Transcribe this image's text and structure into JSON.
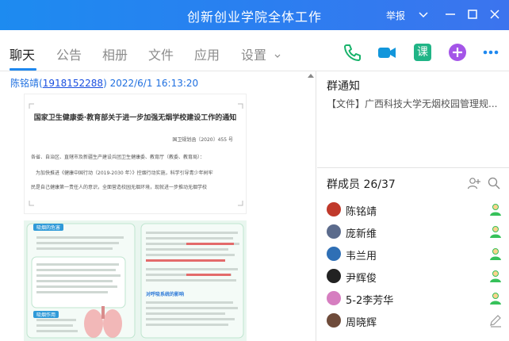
{
  "window": {
    "title": "创新创业学院全体工作",
    "report_label": "举报",
    "buttons": [
      "collapse",
      "minimize",
      "maximize",
      "close"
    ]
  },
  "tabs": [
    {
      "label": "聊天",
      "active": true
    },
    {
      "label": "公告",
      "active": false
    },
    {
      "label": "相册",
      "active": false
    },
    {
      "label": "文件",
      "active": false
    },
    {
      "label": "应用",
      "active": false
    },
    {
      "label": "设置",
      "active": false
    }
  ],
  "toolbar_icons": [
    "phone-icon",
    "video-call-icon",
    "class-icon",
    "add-app-icon",
    "more-icon"
  ],
  "toolbar_class_char": "课",
  "message": {
    "sender": "陈铭靖",
    "qq": "1918152288",
    "timestamp": "2022/6/1 16:13:20",
    "image": {
      "doc_title": "国家卫生健康委·教育部关于进一步加强无烟学校建设工作的通知",
      "doc_no": "国卫规划函〔2020〕455 号",
      "doc_line1": "各省、自治区、直辖市及新疆生产建设兵团卫生健康委、教育厅（教委、教育局）：",
      "doc_line2": "为加快推进《健康中国行动（2019-2030 年）》控烟行动实施，科学引导青少年树牢",
      "doc_line3": "民是自己健康第一责任人的意识，全面营造校园无烟环境，现就进一步推动无烟学校",
      "poster_tag1": "吸烟的危害",
      "poster_tag2": "吸烟作用",
      "poster_heading": "对呼吸系统的影响"
    }
  },
  "group_notice": {
    "heading": "群通知",
    "text": "【文件】广西科技大学无烟校园管理规..."
  },
  "group_members": {
    "heading": "群成员 26/37",
    "members": [
      {
        "name": "陈铭靖",
        "avatar_color": "#c0392b"
      },
      {
        "name": "庞新维",
        "avatar_color": "#5b6b8c"
      },
      {
        "name": "韦兰用",
        "avatar_color": "#2f6fb5"
      },
      {
        "name": "尹辉俊",
        "avatar_color": "#222222"
      },
      {
        "name": "5-2李芳华",
        "avatar_color": "#d67ec0"
      },
      {
        "name": "周晓辉",
        "avatar_color": "#6e4b3a"
      }
    ]
  },
  "colors": {
    "titlebar": "#2a7ff0",
    "accent": "#1e88ef",
    "phone_green": "#17b26a",
    "video_blue": "#1296db",
    "class_green": "#20b486",
    "add_purple": "#a455e8",
    "online_green": "#36c15a",
    "link_blue": "#1e6fe0"
  }
}
